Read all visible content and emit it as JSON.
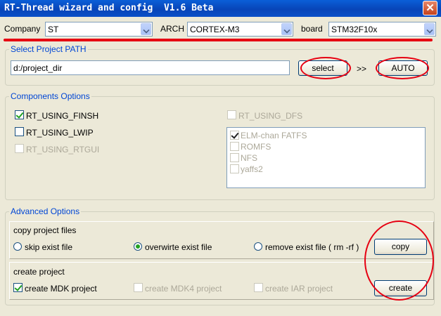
{
  "window": {
    "title": "RT-Thread wizard and config  V1.6 Beta",
    "close_label": "✕"
  },
  "toolbar": {
    "company_label": "Company",
    "company_value": "ST",
    "arch_label": "ARCH",
    "arch_value": "CORTEX-M3",
    "board_label": "board",
    "board_value": "STM32F10x"
  },
  "project_path": {
    "group_title": "Select Project PATH",
    "path_value": "d:/project_dir",
    "select_label": "select",
    "separator": ">>",
    "auto_label": "AUTO"
  },
  "components": {
    "group_title": "Components Options",
    "left": [
      {
        "label": "RT_USING_FINSH",
        "checked": true,
        "enabled": true
      },
      {
        "label": "RT_USING_LWIP",
        "checked": false,
        "enabled": true
      },
      {
        "label": "RT_USING_RTGUI",
        "checked": false,
        "enabled": false
      }
    ],
    "dfs": {
      "label": "RT_USING_DFS",
      "checked": false,
      "enabled": false
    },
    "fs_list": [
      {
        "label": "ELM-chan FATFS",
        "checked": true
      },
      {
        "label": "ROMFS",
        "checked": false
      },
      {
        "label": "NFS",
        "checked": false
      },
      {
        "label": "yaffs2",
        "checked": false
      }
    ]
  },
  "advanced": {
    "group_title": "Advanced Options",
    "copy_panel": {
      "title": "copy project files",
      "options": [
        {
          "label": "skip exist file",
          "selected": false
        },
        {
          "label": "overwirte exist file",
          "selected": true
        },
        {
          "label": "remove exist file ( rm -rf )",
          "selected": false
        }
      ],
      "button_label": "copy"
    },
    "create_panel": {
      "title": "create project",
      "options": [
        {
          "label": "create MDK project",
          "checked": true,
          "enabled": true
        },
        {
          "label": "create MDK4 project",
          "checked": false,
          "enabled": false
        },
        {
          "label": "create IAR project",
          "checked": false,
          "enabled": false
        }
      ],
      "button_label": "create"
    }
  },
  "colors": {
    "titlebar": "#0845b8",
    "group_title": "#0046d5",
    "annotation": "#e60012",
    "window_bg": "#ece9d8"
  }
}
